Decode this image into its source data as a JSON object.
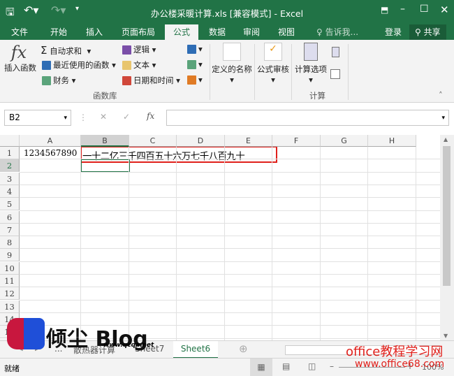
{
  "window": {
    "title": "办公楼采暖计算.xls  [兼容模式] - Excel",
    "accent": "#217346"
  },
  "tabs": [
    {
      "label": "文件"
    },
    {
      "label": "开始"
    },
    {
      "label": "插入"
    },
    {
      "label": "页面布局"
    },
    {
      "label": "公式",
      "active": true
    },
    {
      "label": "数据"
    },
    {
      "label": "审阅"
    },
    {
      "label": "视图"
    }
  ],
  "tell_me": "告诉我...",
  "login": "登录",
  "share": "共享",
  "ribbon": {
    "insert_function": "插入函数",
    "autosum": "自动求和",
    "recent": "最近使用的函数",
    "finance": "财务",
    "logic": "逻辑",
    "text": "文本",
    "datetime": "日期和时间",
    "defined_names": "定义的名称",
    "formula_audit": "公式审核",
    "calc_options": "计算选项",
    "group_library": "函数库",
    "group_calc": "计算"
  },
  "formula_bar": {
    "name_box": "B2",
    "fx": "fx",
    "value": ""
  },
  "columns": [
    "A",
    "B",
    "C",
    "D",
    "E",
    "F",
    "G",
    "H"
  ],
  "rows": [
    "1",
    "2",
    "3",
    "4",
    "5",
    "6",
    "7",
    "8",
    "9",
    "10",
    "11",
    "12",
    "13",
    "14",
    "15",
    "16"
  ],
  "cells": {
    "A1": "1234567890",
    "B1": "一十二亿三千四百五十六万七千八百九十"
  },
  "selected_cell": "B2",
  "sheets": [
    {
      "label": "..."
    },
    {
      "label": "散热器计算"
    },
    {
      "label": "Sheet7"
    },
    {
      "label": "Sheet6",
      "active": true
    }
  ],
  "status": {
    "ready": "就绪",
    "zoom": "100%"
  },
  "watermarks": {
    "logo": "倾尘 Blog",
    "logo_url": "www.qcqa.net",
    "site": "office教程学习网",
    "site_url": "www.office68.com"
  }
}
